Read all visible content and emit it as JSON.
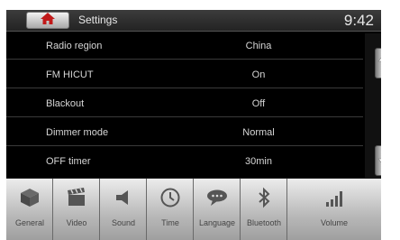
{
  "header": {
    "title": "Settings",
    "time": "9:42",
    "home_icon": "home-icon"
  },
  "settings": [
    {
      "label": "Radio region",
      "value": "China"
    },
    {
      "label": "FM HICUT",
      "value": "On"
    },
    {
      "label": "Blackout",
      "value": "Off"
    },
    {
      "label": "Dimmer mode",
      "value": "Normal"
    },
    {
      "label": "OFF timer",
      "value": "30min"
    }
  ],
  "scroll": {
    "up_icon": "arrow-up-icon",
    "down_icon": "arrow-down-icon"
  },
  "tabs": [
    {
      "label": "General",
      "icon": "cube-icon"
    },
    {
      "label": "Video",
      "icon": "clapperboard-icon"
    },
    {
      "label": "Sound",
      "icon": "speaker-icon"
    },
    {
      "label": "Time",
      "icon": "clock-icon"
    },
    {
      "label": "Language",
      "icon": "speech-bubble-icon"
    },
    {
      "label": "Bluetooth",
      "icon": "bluetooth-icon"
    },
    {
      "label": "Volume",
      "icon": "volume-bars-icon"
    }
  ]
}
